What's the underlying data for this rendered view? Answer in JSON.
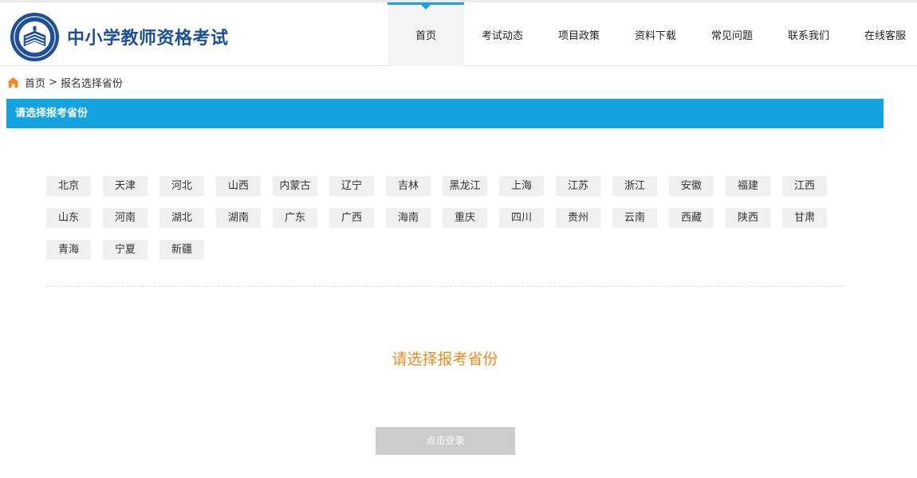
{
  "header": {
    "site_title": "中小学教师资格考试"
  },
  "nav": {
    "items": [
      {
        "label": "首页",
        "active": true
      },
      {
        "label": "考试动态"
      },
      {
        "label": "项目政策"
      },
      {
        "label": "资料下载"
      },
      {
        "label": "常见问题"
      },
      {
        "label": "联系我们"
      },
      {
        "label": "在线客服"
      }
    ]
  },
  "breadcrumb": {
    "home": "首页",
    "separator": ">",
    "current": "报名选择省份",
    "icon": "home-icon"
  },
  "section": {
    "title": "请选择报考省份"
  },
  "provinces": [
    "北京",
    "天津",
    "河北",
    "山西",
    "内蒙古",
    "辽宁",
    "吉林",
    "黑龙江",
    "上海",
    "江苏",
    "浙江",
    "安徽",
    "福建",
    "江西",
    "山东",
    "河南",
    "湖北",
    "湖南",
    "广东",
    "广西",
    "海南",
    "重庆",
    "四川",
    "贵州",
    "云南",
    "西藏",
    "陕西",
    "甘肃",
    "青海",
    "宁夏",
    "新疆"
  ],
  "hint": "请选择报考省份",
  "login_button": "点击登录",
  "colors": {
    "brand_blue": "#13a3e0",
    "title_blue": "#1d4f9a",
    "hint_orange": "#f08a1c",
    "button_disabled": "#cccccc"
  }
}
